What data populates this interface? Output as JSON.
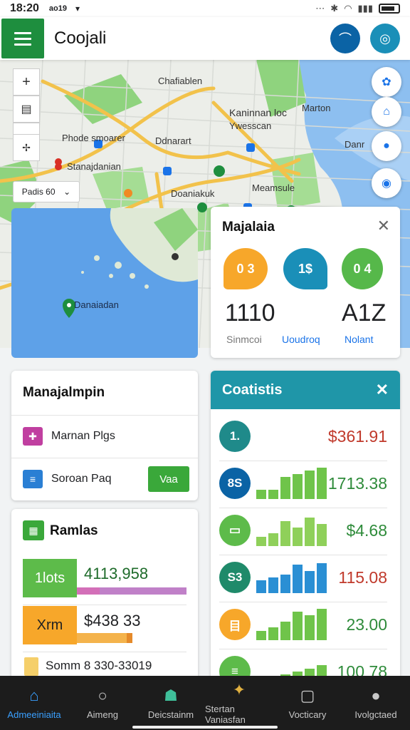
{
  "status": {
    "time": "18:20",
    "carrier": "ao19"
  },
  "app": {
    "title": "Coojali"
  },
  "colors": {
    "brand_green": "#1e8e3e",
    "teal": "#1f96a8",
    "water": "#5ea1e8"
  },
  "map": {
    "labels": [
      "Chafiablen",
      "Kaninnan loc",
      "Ywesscan",
      "Marton",
      "Phode smoarer",
      "Ddnarart",
      "Danr",
      "Stanajdanian",
      "Doaniakuk",
      "Meamsule",
      "Danaiadan"
    ],
    "chip": {
      "label": "Padis 60"
    }
  },
  "card_majalaia": {
    "title": "Majalaia",
    "blobs": [
      "0 3",
      "1$",
      "0 4"
    ],
    "values": [
      "1110",
      "",
      "A1Z"
    ],
    "captions": [
      "Sinmcoi",
      "Uoudroq",
      "Nolant"
    ]
  },
  "card_manajalmpin": {
    "title": "Manajalmpin",
    "items": [
      {
        "label": "Marnan Plgs",
        "icon": "puzzle-icon"
      },
      {
        "label": "Soroan Paq",
        "icon": "document-icon",
        "button": "Vaa"
      }
    ]
  },
  "card_ramlas": {
    "title": "Ramlas",
    "rows": [
      {
        "tag": "1lots",
        "value": "4113,958"
      },
      {
        "tag": "Xrm",
        "value": "$438 33"
      },
      {
        "tag": "",
        "value": "Somm 8 330-33019"
      }
    ]
  },
  "card_coatistis": {
    "title": "Coatistis",
    "rows": [
      {
        "badge": "1.",
        "value": "$361.91",
        "color": "#c0392b"
      },
      {
        "badge": "8S",
        "value": "1713.38",
        "color": "#2e8b3a",
        "bars": [
          0.3,
          0.3,
          0.7,
          0.8,
          0.9,
          1.0
        ]
      },
      {
        "badge": "",
        "value": "$4.68",
        "color": "#2e8b3a",
        "bars": [
          0.3,
          0.4,
          0.8,
          0.6,
          0.9,
          0.7
        ]
      },
      {
        "badge": "S3",
        "value": "115.08",
        "color": "#c0392b",
        "bars": [
          0.4,
          0.5,
          0.6,
          0.9,
          0.7,
          0.95
        ]
      },
      {
        "badge": "",
        "value": "23.00",
        "color": "#2e8b3a",
        "bars": [
          0.3,
          0.4,
          0.6,
          0.9,
          0.8,
          1.0
        ]
      },
      {
        "badge": "",
        "value": "100 78",
        "color": "#2e8b3a",
        "bars": [
          0.2,
          0.3,
          0.4,
          0.5,
          0.6,
          0.7
        ]
      }
    ]
  },
  "nav": [
    {
      "label": "Admeeiniaita",
      "icon": "home-icon"
    },
    {
      "label": "Aimeng",
      "icon": "search-icon"
    },
    {
      "label": "Deicstainm",
      "icon": "person-icon"
    },
    {
      "label": "Stertan Vaniasfan",
      "icon": "explore-icon"
    },
    {
      "label": "Vocticary",
      "icon": "image-icon"
    },
    {
      "label": "Ivolgctaed",
      "icon": "profile-icon"
    }
  ]
}
